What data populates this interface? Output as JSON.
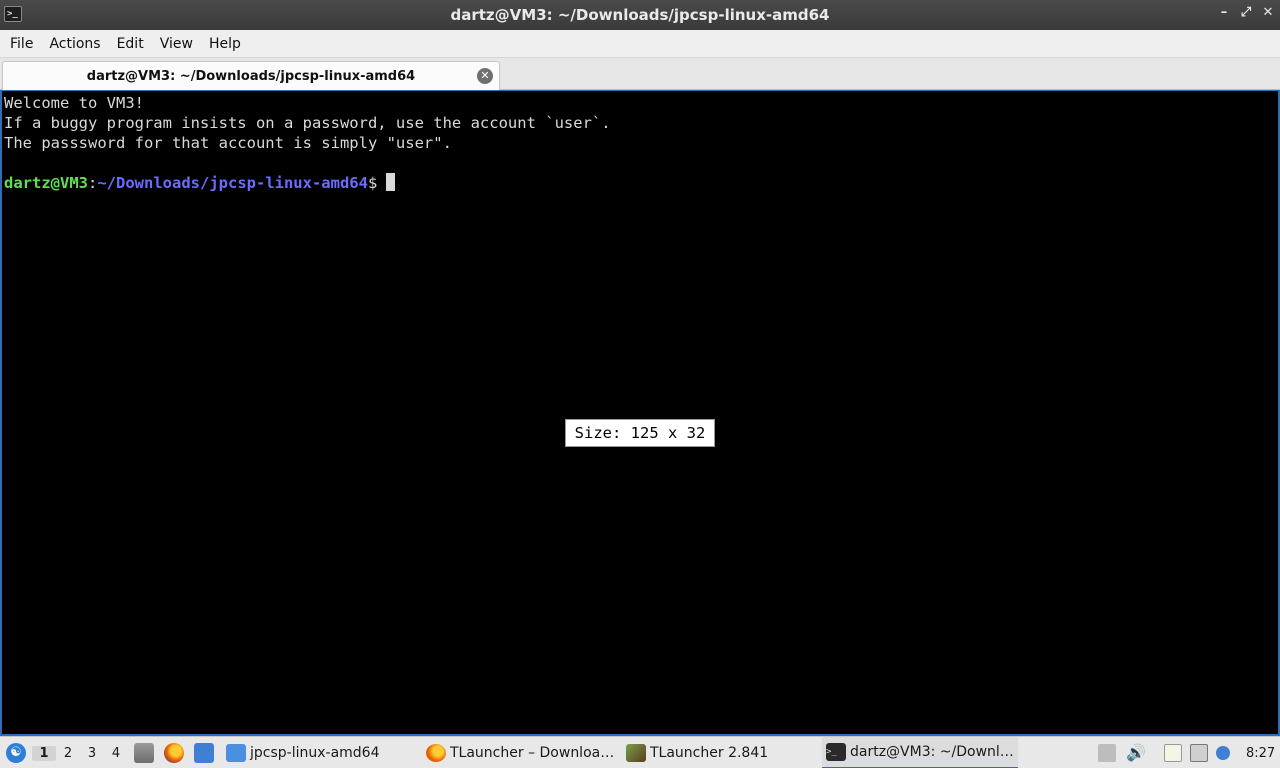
{
  "window": {
    "title": "dartz@VM3: ~/Downloads/jpcsp-linux-amd64",
    "controls": [
      "–",
      "⤢",
      "✕"
    ]
  },
  "menu": [
    "File",
    "Actions",
    "Edit",
    "View",
    "Help"
  ],
  "tab": {
    "label": "dartz@VM3: ~/Downloads/jpcsp-linux-amd64",
    "close_glyph": "✕"
  },
  "terminal": {
    "lines": [
      "Welcome to VM3!",
      "If a buggy program insists on a password, use the account `user`.",
      "The passsword for that account is simply \"user\"."
    ],
    "prompt": {
      "user_host": "dartz@VM3",
      "colon": ":",
      "path": "~/Downloads/jpcsp-linux-amd64",
      "symbol": "$"
    },
    "size_tooltip": "Size: 125 x 32"
  },
  "taskbar": {
    "start_icon": "lxqt-menu-icon",
    "workspaces": [
      "1",
      "2",
      "3",
      "4"
    ],
    "active_workspace": "1",
    "quicklaunch": [
      "file-manager-icon",
      "firefox-icon",
      "desktop-icon"
    ],
    "tasks": [
      {
        "label": "jpcsp-linux-amd64",
        "icon": "folder-icon",
        "color": "#4a8fe0"
      },
      {
        "label": "TLauncher – Downloa…",
        "icon": "firefox-icon",
        "color": "#e66000"
      },
      {
        "label": "TLauncher 2.841",
        "icon": "minecraft-block-icon",
        "color": "#6b8e3a"
      },
      {
        "label": "dartz@VM3: ~/Downl…",
        "icon": "terminal-icon",
        "color": "#2a2a2a"
      }
    ],
    "clock": "8:27"
  }
}
